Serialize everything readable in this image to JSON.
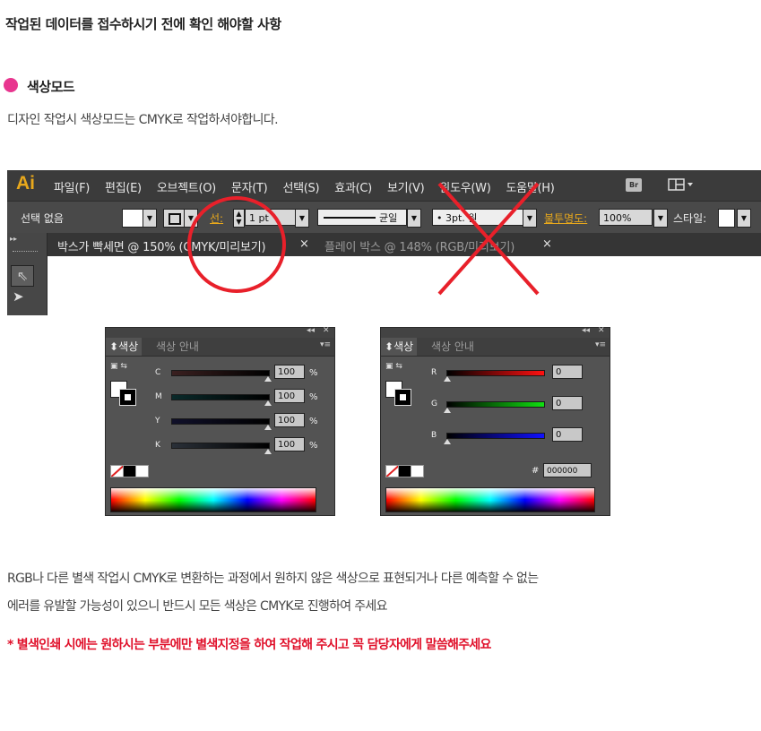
{
  "page_title": "작업된 데이터를 접수하시기 전에 확인 해야할 사항",
  "section": {
    "title": "색상모드",
    "description": "디자인 작업시 색상모드는 CMYK로 작업하셔야합니다.",
    "bullet_color": "#e8368f"
  },
  "illustrator": {
    "logo": "Ai",
    "menu": [
      "파일(F)",
      "편집(E)",
      "오브젝트(O)",
      "문자(T)",
      "선택(S)",
      "효과(C)",
      "보기(V)",
      "윈도우(W)",
      "도움말(H)"
    ],
    "bridge_button": "Br",
    "workspace_icon": "layout-icon",
    "control_bar": {
      "selection": "선택 없음",
      "stroke_label": "선:",
      "stroke_weight": "1 pt",
      "stroke_style": "균일",
      "brush": "• 3pt. 원",
      "opacity_label": "불투명도:",
      "opacity_value": "100%",
      "style_label": "스타일:"
    },
    "tabs": [
      {
        "label": "박스가 빡세면 @ 150% (CMYK/미리보기)",
        "close": "×"
      },
      {
        "label": "플레이 박스 @ 148% (RGB/미리보기)",
        "close": "×"
      }
    ],
    "mark_circle_color": "#e8202a",
    "mark_x_color": "#e8202a"
  },
  "panels": {
    "cmyk": {
      "tab_active": "색상",
      "tab_inactive": "색상 안내",
      "sliders": [
        {
          "label": "C",
          "value": "100",
          "unit": "%"
        },
        {
          "label": "M",
          "value": "100",
          "unit": "%"
        },
        {
          "label": "Y",
          "value": "100",
          "unit": "%"
        },
        {
          "label": "K",
          "value": "100",
          "unit": "%"
        }
      ]
    },
    "rgb": {
      "tab_active": "색상",
      "tab_inactive": "색상 안내",
      "sliders": [
        {
          "label": "R",
          "value": "0",
          "color": "#c81010"
        },
        {
          "label": "G",
          "value": "0",
          "color": "#10b010"
        },
        {
          "label": "B",
          "value": "0",
          "color": "#1010d0"
        }
      ],
      "hex_label": "#",
      "hex_value": "000000"
    }
  },
  "body": {
    "line1": "RGB나 다른 별색 작업시 CMYK로 변환하는 과정에서 원하지 않은 색상으로 표현되거나 다른 예측할 수 없는",
    "line2": "에러를 유발할 가능성이 있으니 반드시 모든 색상은 CMYK로 진행하여 주세요",
    "warning": "* 별색인쇄 시에는 원하시는 부분에만 별색지정을 하여 작업해 주시고 꼭 담당자에게 말씀해주세요",
    "warning_color": "#e0102a"
  }
}
